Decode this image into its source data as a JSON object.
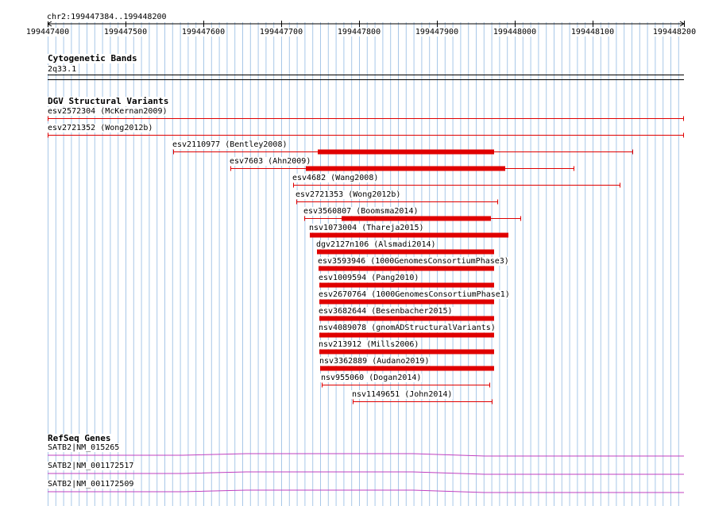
{
  "region": {
    "label": "chr2:199447384..199448200",
    "start": 199447384,
    "end": 199448200
  },
  "ruler": {
    "ticks": [
      "199447400",
      "199447500",
      "199447600",
      "199447700",
      "199447800",
      "199447900",
      "199448000",
      "199448100",
      "199448200"
    ]
  },
  "cyto": {
    "title": "Cytogenetic Bands",
    "band": "2q33.1"
  },
  "dgv": {
    "title": "DGV Structural Variants",
    "variants": [
      {
        "label": "esv2572304 (McKernan2009)",
        "color": "#e00000"
      },
      {
        "label": "esv2721352 (Wong2012b)",
        "color": "#e00000"
      },
      {
        "label": "esv2110977 (Bentley2008)",
        "color": "#e00000"
      },
      {
        "label": "esv7603 (Ahn2009)",
        "color": "#e00000"
      },
      {
        "label": "esv4682 (Wang2008)",
        "color": "#e00000"
      },
      {
        "label": "esv2721353 (Wong2012b)",
        "color": "#e00000"
      },
      {
        "label": "esv3560807 (Boomsma2014)",
        "color": "#e00000"
      },
      {
        "label": "nsv1073004 (Thareja2015)",
        "color": "#e00000"
      },
      {
        "label": "dgv2127n106 (Alsmadi2014)",
        "color": "#e00000"
      },
      {
        "label": "esv3593946 (1000GenomesConsortiumPhase3)",
        "color": "#e00000"
      },
      {
        "label": "esv1009594 (Pang2010)",
        "color": "#e00000"
      },
      {
        "label": "esv2670764 (1000GenomesConsortiumPhase1)",
        "color": "#e00000"
      },
      {
        "label": "esv3682644 (Besenbacher2015)",
        "color": "#e00000"
      },
      {
        "label": "nsv4089078 (gnomADStructuralVariants)",
        "color": "#e00000"
      },
      {
        "label": "nsv213912 (Mills2006)",
        "color": "#e00000"
      },
      {
        "label": "nsv3362889 (Audano2019)",
        "color": "#e00000"
      },
      {
        "label": "nsv955060 (Dogan2014)",
        "color": "#e00000"
      },
      {
        "label": "nsv1149651 (John2014)",
        "color": "#e00000"
      }
    ]
  },
  "refseq": {
    "title": "RefSeq Genes",
    "genes": [
      {
        "label": "SATB2|NM_015265",
        "color": "#c040c0"
      },
      {
        "label": "SATB2|NM_001172517",
        "color": "#c040c0"
      },
      {
        "label": "SATB2|NM_001172509",
        "color": "#c040c0"
      }
    ]
  },
  "colors": {
    "grid": "#a8c8e8",
    "variant": "#e00000",
    "gene": "#c040c0"
  }
}
